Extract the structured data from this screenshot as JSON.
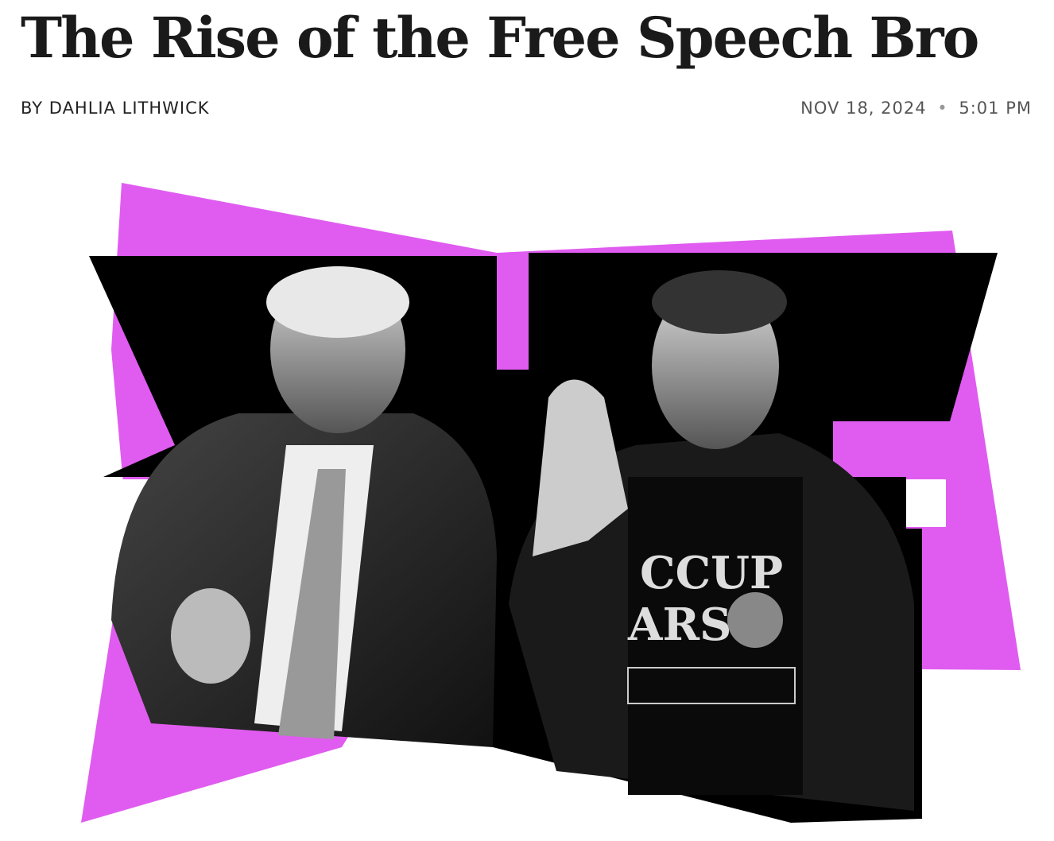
{
  "article": {
    "title": "The Rise of the Free Speech Bro",
    "byline": "BY DAHLIA LITHWICK",
    "date": "NOV 18, 2024",
    "separator": "•",
    "time": "5:01 PM"
  },
  "hero_image": {
    "description_colors": {
      "accent": "#e05cf0",
      "black": "#000000"
    },
    "shirt_text": [
      "CCUP",
      "ARS"
    ]
  }
}
